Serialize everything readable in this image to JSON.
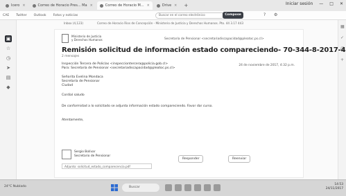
{
  "tabs": [
    {
      "label": "Icero",
      "active": false
    },
    {
      "label": "Correo de Horacio Pres... Ma",
      "active": false
    },
    {
      "label": "Correo de Horacio M...",
      "active": true
    },
    {
      "label": "Drive",
      "active": false
    }
  ],
  "window_controls": {
    "profile": "Iniciar sesión",
    "minimize": "—",
    "maximize": "□",
    "close": "✕"
  },
  "bookmarks": [
    "CAE",
    "Twitter",
    "Outlook",
    "Fotos y noticias"
  ],
  "search_placeholder": "Buscar en el correo electrónico",
  "apps_button": "Compose",
  "mail_header_strip": [
    "Inbox (4,123)",
    "Correo de Horacio Rios de Concepción - Ministerio de Justicia y Derechos Humanos. Pto. 44 3.17 443"
  ],
  "mail": {
    "org_name": [
      "Ministerio de Justicia",
      "y Derechos Humanos"
    ],
    "top_line": "Secretaría de Pensionar <secretariadiscapacidad@pleatoc.ps.cl>",
    "subject": "Remisión solicitud de información estado compareciendo- 70-344-8-2017-433",
    "messages": "2 mensajes",
    "from_line": "Inspección Tercera de Policías <inspecciontercera@policia.gob.cl>",
    "to_line": "Para: Secretaría de Pensionar <secretariadiscapacidad@pleatoc.ps.cl>",
    "date": "24 de noviembre de 2017, 4:32 p.m.",
    "greeting": [
      "Señorita Evelina Mondaca",
      "Secretaría de Pensionar",
      "Ciudad"
    ],
    "salutation": "Cordial saludo",
    "body": "De conformidad a lo solicitado se adjunta información estado compareciendo. Favor dar curso.",
    "closing": "Atentamente,",
    "sig_name": [
      "Sergio Bolívar",
      "Secretario de Pensionar"
    ],
    "attach_label": "Adjunto: solicitud_estado_comparecencia.pdf",
    "reply_button": "Responder",
    "forward_button": "Reenviar"
  },
  "taskbar": {
    "weather": "24°C Nublado",
    "search": "Buscar",
    "time": "14:53",
    "date": "24/11/2017"
  }
}
